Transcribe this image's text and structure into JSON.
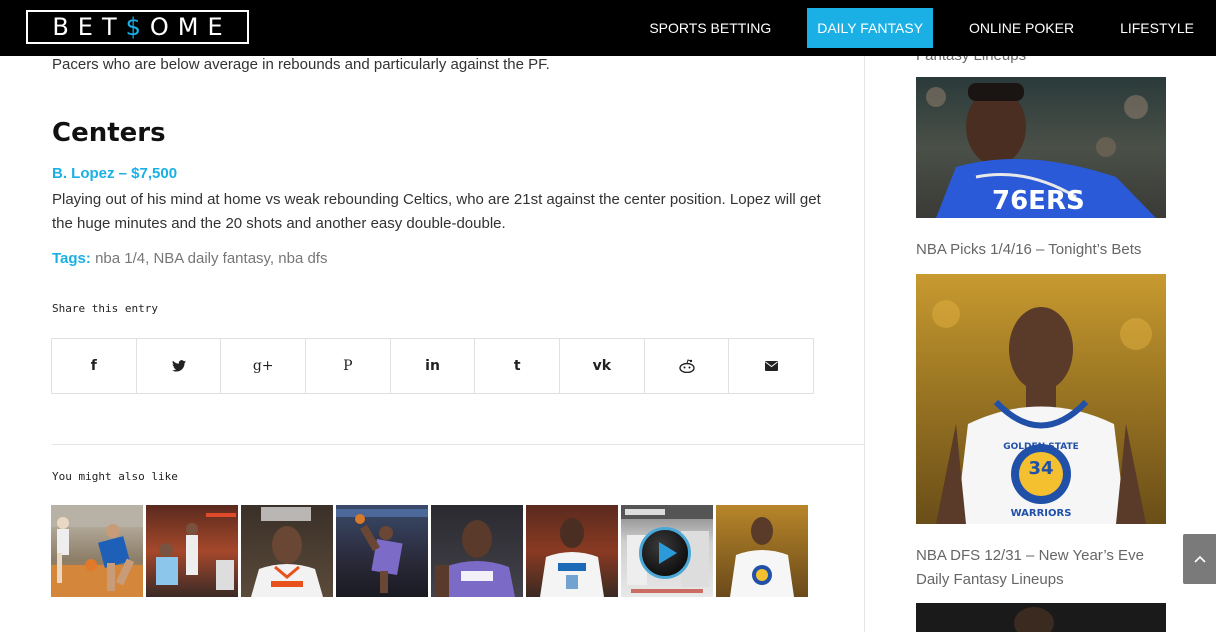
{
  "header": {
    "logo_prefix": "BET",
    "logo_dollar": "$",
    "logo_suffix": "OME",
    "nav": [
      {
        "label": "SPORTS BETTING",
        "active": false
      },
      {
        "label": "DAILY FANTASY",
        "active": true
      },
      {
        "label": "ONLINE POKER",
        "active": false
      },
      {
        "label": "LIFESTYLE",
        "active": false
      }
    ]
  },
  "article": {
    "intro_text": "Pacers who are below average in rebounds and particularly against the PF.",
    "section_title": "Centers",
    "player_link": "B. Lopez – $7,500",
    "player_text": "Playing out of his mind at home vs weak rebounding Celtics, who are 21st against the center position. Lopez will get the huge minutes and the 20 shots and another easy double-double.",
    "tags_label": "Tags:",
    "tags": [
      "nba 1/4",
      "NBA daily fantasy",
      "nba dfs"
    ],
    "share_label": "Share this entry",
    "share_buttons": [
      {
        "icon": "facebook-icon",
        "glyph": "f"
      },
      {
        "icon": "twitter-icon",
        "glyph": "🐦"
      },
      {
        "icon": "google-plus-icon",
        "glyph": "g+"
      },
      {
        "icon": "pinterest-icon",
        "glyph": "P"
      },
      {
        "icon": "linkedin-icon",
        "glyph": "in"
      },
      {
        "icon": "tumblr-icon",
        "glyph": "t"
      },
      {
        "icon": "vk-icon",
        "glyph": "vk"
      },
      {
        "icon": "reddit-icon",
        "glyph": "◉"
      },
      {
        "icon": "mail-icon",
        "glyph": "✉"
      }
    ],
    "related_label": "You might also like"
  },
  "sidebar": {
    "caption_top": "Fantasy Lineups",
    "caption_1": "NBA Picks 1/4/16 – Tonight’s Bets",
    "caption_2": "NBA DFS 12/31 – New Year’s Eve Daily Fantasy Lineups",
    "jersey_1_text": "76ERS",
    "jersey_2_team": "GOLDEN STATE",
    "jersey_2_number": "34",
    "jersey_2_word": "WARRIORS"
  },
  "colors": {
    "accent": "#1ab0e6",
    "header_bg": "#000000"
  }
}
